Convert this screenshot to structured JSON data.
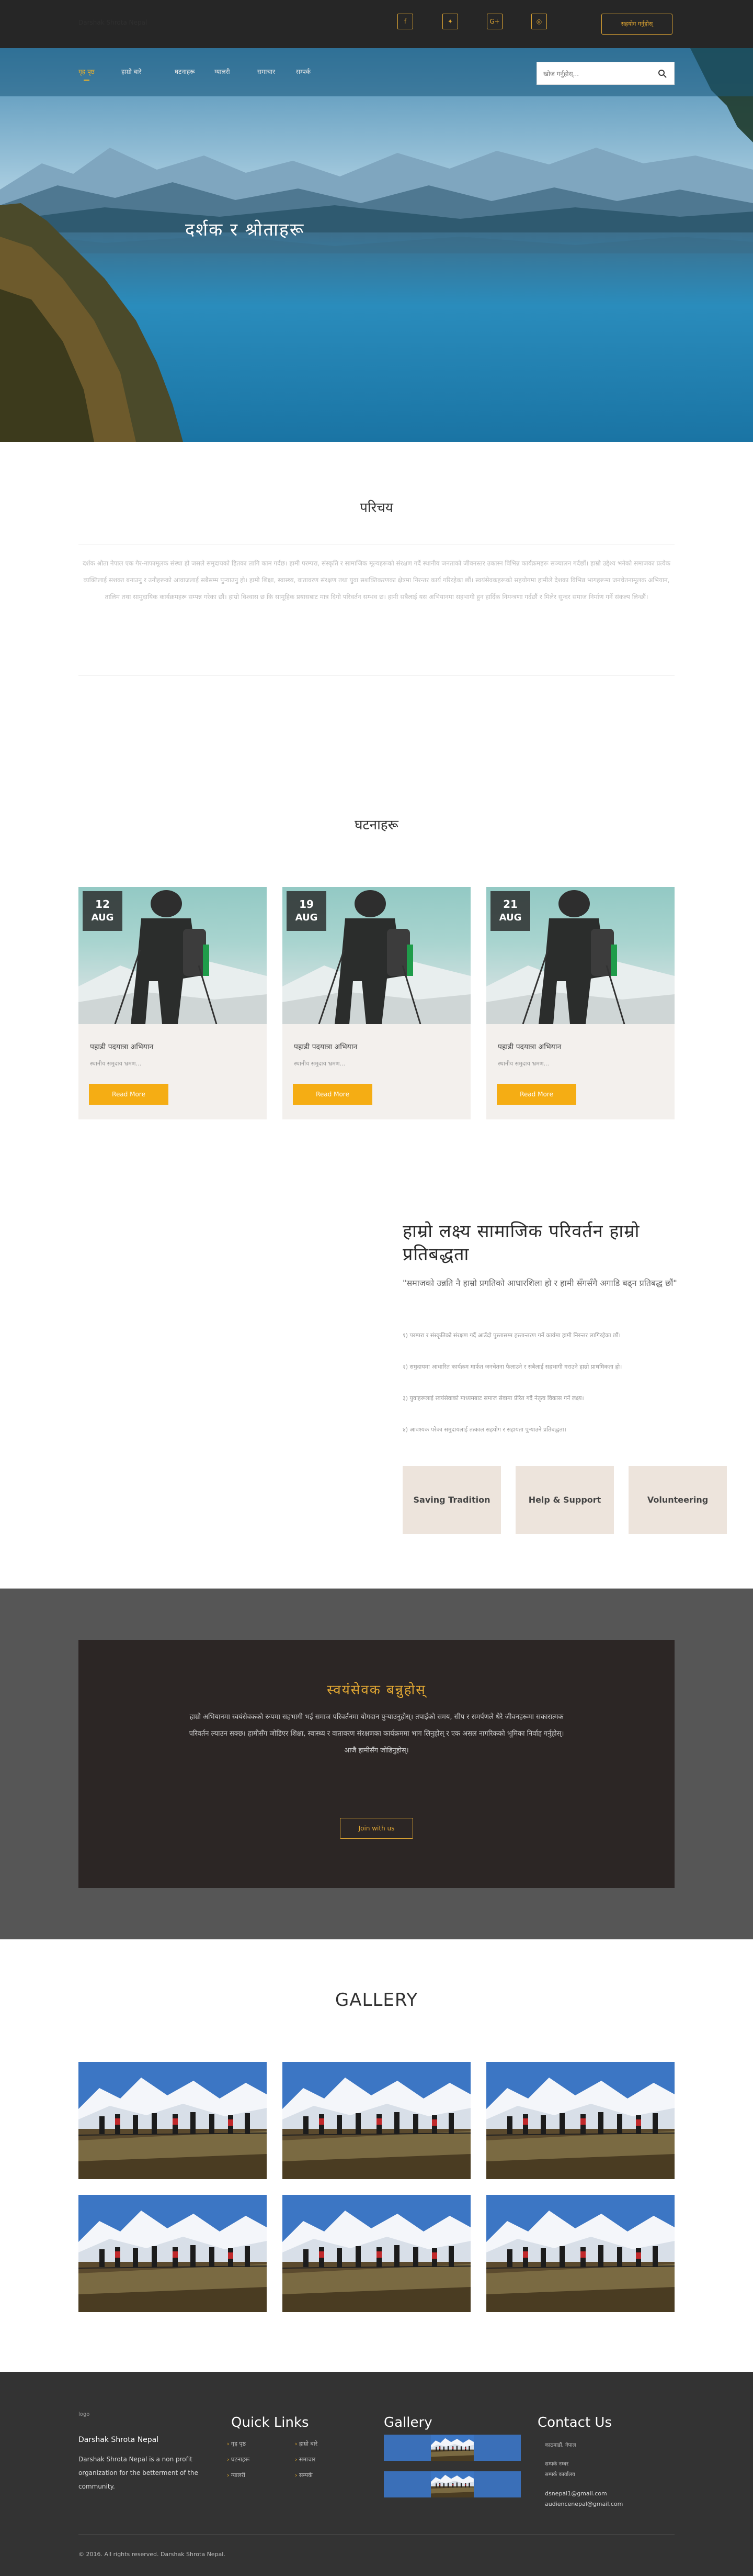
{
  "topbar": {
    "brand": "Darshak Shrota Nepal",
    "social": [
      {
        "icon": "facebook-icon",
        "glyph": "f"
      },
      {
        "icon": "twitter-icon",
        "glyph": "✦"
      },
      {
        "icon": "google-plus-icon",
        "glyph": "G+"
      },
      {
        "icon": "instagram-icon",
        "glyph": "◎"
      }
    ],
    "donate_label": "सहयोग गर्नुहोस्"
  },
  "nav": {
    "items": [
      "गृह पृष्ठ",
      "हाम्रो बारे",
      "घटनाहरू",
      "ग्यालरी",
      "समाचार",
      "सम्पर्क"
    ],
    "active_index": 0,
    "search_placeholder": "खोज गर्नुहोस्..."
  },
  "hero": {
    "title": "दर्शक र श्रोताहरू"
  },
  "about": {
    "title": "परिचय",
    "text": "दर्शक श्रोता नेपाल एक गैर-नाफामूलक संस्था हो जसले समुदायको हितका लागि काम गर्दछ। हामी परम्परा, संस्कृति र सामाजिक मूल्यहरूको संरक्षण गर्दै स्थानीय जनताको जीवनस्तर उकास्न विभिन्न कार्यक्रमहरू सञ्चालन गर्दछौं। हाम्रो उद्देश्य भनेको समाजका प्रत्येक व्यक्तिलाई सशक्त बनाउनु र उनीहरूको आवाजलाई सबैसम्म पुर्‍याउनु हो। हामी शिक्षा, स्वास्थ्य, वातावरण संरक्षण तथा युवा सशक्तिकरणका क्षेत्रमा निरन्तर कार्य गरिरहेका छौं। स्वयंसेवकहरूको सहयोगमा हामीले देशका विभिन्न भागहरूमा जनचेतनामूलक अभियान, तालिम तथा सामुदायिक कार्यक्रमहरू सम्पन्न गरेका छौं। हाम्रो विश्वास छ कि सामूहिक प्रयासबाट मात्र दिगो परिवर्तन सम्भव छ। हामी सबैलाई यस अभियानमा सहभागी हुन हार्दिक निमन्त्रणा गर्दछौं र मिलेर सुन्दर समाज निर्माण गर्ने संकल्प लिन्छौं।"
  },
  "events": {
    "title": "घटनाहरू",
    "items": [
      {
        "day": "12",
        "month": "AUG",
        "title": "पहाडी पदयात्रा अभियान",
        "sub": "स्थानीय समुदाय भ्रमण...",
        "button": "Read More"
      },
      {
        "day": "19",
        "month": "AUG",
        "title": "पहाडी पदयात्रा अभियान",
        "sub": "स्थानीय समुदाय भ्रमण...",
        "button": "Read More"
      },
      {
        "day": "21",
        "month": "AUG",
        "title": "पहाडी पदयात्रा अभियान",
        "sub": "स्थानीय समुदाय भ्रमण...",
        "button": "Read More"
      }
    ]
  },
  "mission": {
    "title": "हाम्रो लक्ष्य सामाजिक परिवर्तन हाम्रो प्रतिबद्धता",
    "quote": "\"समाजको उन्नति नै हाम्रो प्रगतिको आधारशिला हो र हामी सँगसँगै अगाडि बढ्न प्रतिबद्ध छौं\"",
    "points": [
      "१) परम्परा र संस्कृतिको संरक्षण गर्दै आउँदो पुस्तासम्म हस्तान्तरण गर्ने कार्यमा हामी निरन्तर लागिरहेका छौं।",
      "२) समुदायमा आधारित कार्यक्रम मार्फत जनचेतना फैलाउने र सबैलाई सहभागी गराउने हाम्रो प्राथमिकता हो।",
      "३) युवाहरूलाई स्वयंसेवाको माध्यमबाट समाज सेवामा प्रेरित गर्दै नेतृत्व विकास गर्ने लक्ष्य।",
      "४) आवश्यक परेका समुदायलाई तत्काल सहयोग र सहायता पुर्‍याउने प्रतिबद्धता।"
    ],
    "values": [
      "Saving Tradition",
      "Help & Support",
      "Volunteering"
    ]
  },
  "volunteer": {
    "title": "स्वयंसेवक बन्नुहोस्",
    "text": "हाम्रो अभियानमा स्वयंसेवकको रूपमा सहभागी भई समाज परिवर्तनमा योगदान पुर्‍याउनुहोस्। तपाईंको समय, सीप र समर्पणले धेरै जीवनहरूमा सकारात्मक परिवर्तन ल्याउन सक्छ। हामीसँग जोडिएर शिक्षा, स्वास्थ्य र वातावरण संरक्षणका कार्यक्रममा भाग लिनुहोस् र एक असल नागरिकको भूमिका निर्वाह गर्नुहोस्। आजै हामीसँग जोडिनुहोस्।",
    "button": "Join with us"
  },
  "gallery": {
    "title": "GALLERY"
  },
  "footer": {
    "org_name": "Darshak Shrota Nepal",
    "org_desc": "Darshak Shrota Nepal is a non profit organization for the betterment of the community.",
    "quick_links_title": "Quick Links",
    "links_col1": [
      "गृह पृष्ठ",
      "घटनाहरू",
      "ग्यालरी"
    ],
    "links_col2": [
      "हाम्रो बारे",
      "समाचार",
      "सम्पर्क"
    ],
    "gallery_title": "Gallery",
    "contact_title": "Contact Us",
    "contact_lines": [
      "काठमाडौं, नेपाल",
      "सम्पर्क नम्बर",
      "सम्पर्क कार्यालय"
    ],
    "emails": [
      "dsnepal1@gmail.com",
      "audiencenepal@gmail.com"
    ],
    "copyright": "© 2016. All rights reserved. Darshak Shrota Nepal.",
    "logo_alt": "logo"
  }
}
